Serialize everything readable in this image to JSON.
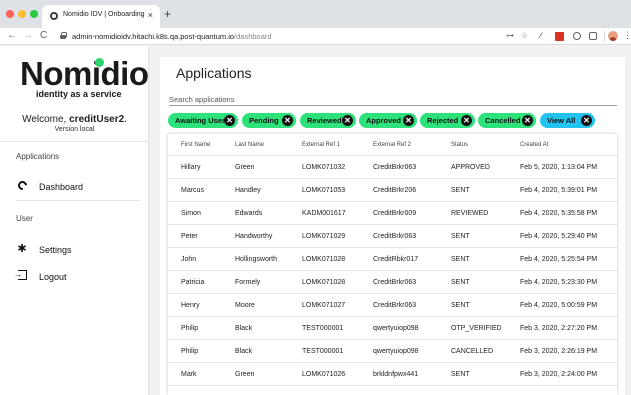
{
  "browser": {
    "tab_title": "Nomidio IDV | Onboarding",
    "tab_close": "×",
    "new_tab": "+",
    "url_host": "admin-nomidioidv.hitachi.k8s.qa.post-quantum.io",
    "url_path": "/dashboard",
    "nav_back": "←",
    "nav_forward": "→",
    "nav_reload": "C",
    "key_icon": "⊶",
    "star_icon": "☆",
    "pen_icon": "∕",
    "menu_dots": "⋮"
  },
  "sidebar": {
    "logo_text": "Nomidio",
    "tagline": "identity as a service",
    "welcome_prefix": "Welcome, ",
    "username": "creditUser2",
    "welcome_suffix": ".",
    "version": "Version local",
    "section_applications": "Applications",
    "dashboard_label": "Dashboard",
    "section_user": "User",
    "settings_label": "Settings",
    "logout_label": "Logout"
  },
  "main": {
    "title": "Applications",
    "search_placeholder": "Search applications"
  },
  "filters": [
    {
      "label": "Awaiting User",
      "color": "#2ee27b"
    },
    {
      "label": "Pending",
      "color": "#2ee27b"
    },
    {
      "label": "Reviewed",
      "color": "#2ee27b"
    },
    {
      "label": "Approved",
      "color": "#2ee27b"
    },
    {
      "label": "Rejected",
      "color": "#2ee27b"
    },
    {
      "label": "Cancelled",
      "color": "#2ee27b"
    },
    {
      "label": "View All",
      "color": "#22c4ef"
    }
  ],
  "filter_close_glyph": "✕",
  "table": {
    "columns": [
      "First Name",
      "Last Name",
      "External Ref 1",
      "External Ref 2",
      "Status",
      "Created At"
    ],
    "rows": [
      [
        "Hillary",
        "Green",
        "LOMK071032",
        "CreditBrkr063",
        "APPROVED",
        "Feb 5, 2020, 1:13:04 PM"
      ],
      [
        "Marcus",
        "Handley",
        "LOMK071053",
        "CreditBrkr206",
        "SENT",
        "Feb 4, 2020, 5:39:01 PM"
      ],
      [
        "Simon",
        "Edwards",
        "KADM001617",
        "CreditBrkr009",
        "REVIEWED",
        "Feb 4, 2020, 5:35:58 PM"
      ],
      [
        "Peter",
        "Handworthy",
        "LOMK071029",
        "CreditBrkr063",
        "SENT",
        "Feb 4, 2020, 5:29:40 PM"
      ],
      [
        "John",
        "Hollingsworth",
        "LOMK071028",
        "CreditRbkr017",
        "SENT",
        "Feb 4, 2020, 5:25:54 PM"
      ],
      [
        "Patricia",
        "Formely",
        "LOMK071028",
        "CreditBrkr063",
        "SENT",
        "Feb 4, 2020, 5:23:30 PM"
      ],
      [
        "Henry",
        "Moore",
        "LOMK071027",
        "CreditBrkr063",
        "SENT",
        "Feb 4, 2020, 5:00:59 PM"
      ],
      [
        "Philip",
        "Black",
        "TEST000001",
        "qwertyuiop098",
        "OTP_VERIFIED",
        "Feb 3, 2020, 2:27:20 PM"
      ],
      [
        "Philip",
        "Black",
        "TEST000001",
        "qwertyuiop098",
        "CANCELLED",
        "Feb 3, 2020, 2:26:19 PM"
      ],
      [
        "Mark",
        "Green",
        "LOMK071026",
        "brkldnfpwx441",
        "SENT",
        "Feb 3, 2020, 2:24:00 PM"
      ]
    ]
  }
}
